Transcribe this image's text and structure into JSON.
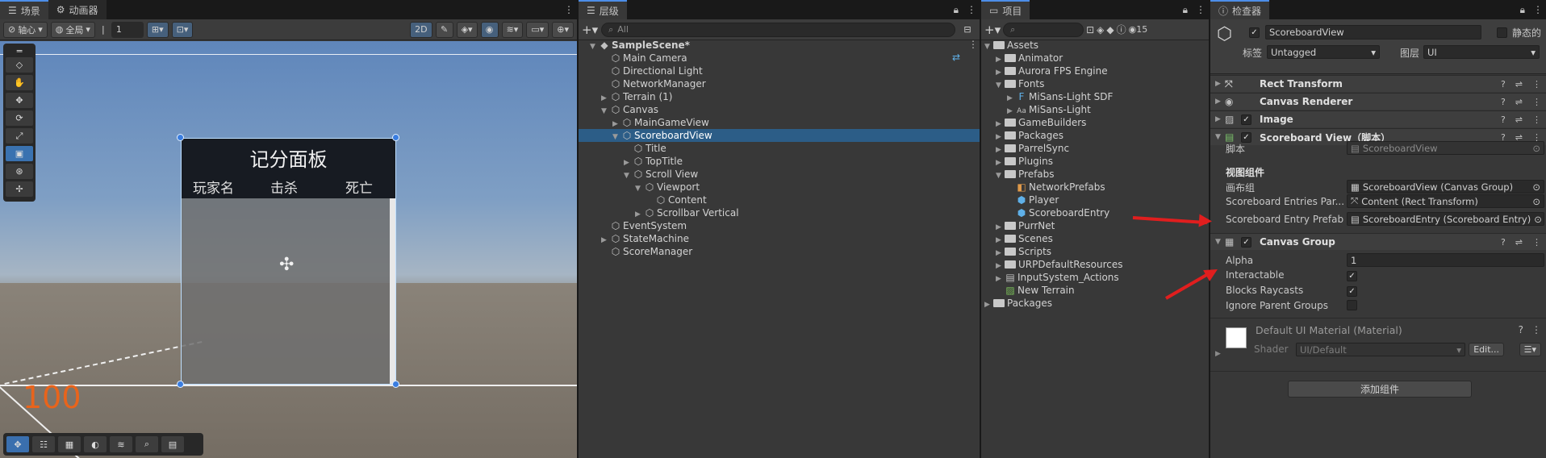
{
  "scene_panel": {
    "tabs": [
      {
        "label": "场景",
        "icon": "menu-icon"
      },
      {
        "label": "动画器",
        "icon": "animator-icon"
      }
    ],
    "toolbar": {
      "pivot": "轴心",
      "global": "全局",
      "grid_value": "1",
      "mode_2d": "2D"
    },
    "canvas_title": "记分面板",
    "columns": [
      "玩家名",
      "击杀",
      "死亡"
    ],
    "overlay_number": "100"
  },
  "hierarchy": {
    "tab": "层级",
    "search_placeholder": "All",
    "items": [
      {
        "label": "SampleScene*",
        "depth": 0,
        "arrow": "▼",
        "icon": "unity-icon",
        "bold": true
      },
      {
        "label": "Main Camera",
        "depth": 1,
        "arrow": "",
        "icon": "cube-icon"
      },
      {
        "label": "Directional Light",
        "depth": 1,
        "arrow": "",
        "icon": "cube-icon"
      },
      {
        "label": "NetworkManager",
        "depth": 1,
        "arrow": "",
        "icon": "cube-icon"
      },
      {
        "label": "Terrain (1)",
        "depth": 1,
        "arrow": "▶",
        "icon": "cube-icon"
      },
      {
        "label": "Canvas",
        "depth": 1,
        "arrow": "▼",
        "icon": "cube-icon"
      },
      {
        "label": "MainGameView",
        "depth": 2,
        "arrow": "▶",
        "icon": "cube-icon"
      },
      {
        "label": "ScoreboardView",
        "depth": 2,
        "arrow": "▼",
        "icon": "cube-icon",
        "selected": true
      },
      {
        "label": "Title",
        "depth": 3,
        "arrow": "",
        "icon": "cube-icon"
      },
      {
        "label": "TopTitle",
        "depth": 3,
        "arrow": "▶",
        "icon": "cube-icon"
      },
      {
        "label": "Scroll View",
        "depth": 3,
        "arrow": "▼",
        "icon": "cube-icon"
      },
      {
        "label": "Viewport",
        "depth": 4,
        "arrow": "▼",
        "icon": "cube-icon"
      },
      {
        "label": "Content",
        "depth": 5,
        "arrow": "",
        "icon": "cube-icon"
      },
      {
        "label": "Scrollbar Vertical",
        "depth": 4,
        "arrow": "▶",
        "icon": "cube-icon"
      },
      {
        "label": "EventSystem",
        "depth": 1,
        "arrow": "",
        "icon": "cube-icon"
      },
      {
        "label": "StateMachine",
        "depth": 1,
        "arrow": "▶",
        "icon": "cube-icon"
      },
      {
        "label": "ScoreManager",
        "depth": 1,
        "arrow": "",
        "icon": "cube-icon"
      }
    ]
  },
  "project": {
    "tab": "项目",
    "badge_count": "15",
    "items": [
      {
        "label": "Assets",
        "depth": 0,
        "arrow": "▼",
        "icon": "folder"
      },
      {
        "label": "Animator",
        "depth": 1,
        "arrow": "▶",
        "icon": "folder"
      },
      {
        "label": "Aurora FPS Engine",
        "depth": 1,
        "arrow": "▶",
        "icon": "folder"
      },
      {
        "label": "Fonts",
        "depth": 1,
        "arrow": "▼",
        "icon": "folder"
      },
      {
        "label": "MiSans-Light SDF",
        "depth": 2,
        "arrow": "▶",
        "icon": "font-asset-icon"
      },
      {
        "label": "MiSans-Light",
        "depth": 2,
        "arrow": "▶",
        "icon": "font-icon"
      },
      {
        "label": "GameBuilders",
        "depth": 1,
        "arrow": "▶",
        "icon": "folder"
      },
      {
        "label": "Packages",
        "depth": 1,
        "arrow": "▶",
        "icon": "folder"
      },
      {
        "label": "ParrelSync",
        "depth": 1,
        "arrow": "▶",
        "icon": "folder"
      },
      {
        "label": "Plugins",
        "depth": 1,
        "arrow": "▶",
        "icon": "folder"
      },
      {
        "label": "Prefabs",
        "depth": 1,
        "arrow": "▼",
        "icon": "folder"
      },
      {
        "label": "NetworkPrefabs",
        "depth": 2,
        "arrow": "",
        "icon": "network-prefab-icon"
      },
      {
        "label": "Player",
        "depth": 2,
        "arrow": "",
        "icon": "prefab-icon"
      },
      {
        "label": "ScoreboardEntry",
        "depth": 2,
        "arrow": "",
        "icon": "prefab-icon"
      },
      {
        "label": "PurrNet",
        "depth": 1,
        "arrow": "▶",
        "icon": "folder"
      },
      {
        "label": "Scenes",
        "depth": 1,
        "arrow": "▶",
        "icon": "folder"
      },
      {
        "label": "Scripts",
        "depth": 1,
        "arrow": "▶",
        "icon": "folder"
      },
      {
        "label": "URPDefaultResources",
        "depth": 1,
        "arrow": "▶",
        "icon": "folder"
      },
      {
        "label": "InputSystem_Actions",
        "depth": 1,
        "arrow": "▶",
        "icon": "input-actions-icon"
      },
      {
        "label": "New Terrain",
        "depth": 1,
        "arrow": "",
        "icon": "terrain-icon"
      },
      {
        "label": "Packages",
        "depth": 0,
        "arrow": "▶",
        "icon": "folder"
      }
    ]
  },
  "inspector": {
    "tab": "检查器",
    "object_name": "ScoreboardView",
    "static_label": "静态的",
    "tag_label": "标签",
    "tag_value": "Untagged",
    "layer_label": "图层",
    "layer_value": "UI",
    "components": [
      {
        "label": "Rect Transform",
        "icon": "rect-transform-icon",
        "checkbox": false
      },
      {
        "label": "Canvas Renderer",
        "icon": "eye-icon",
        "checkbox": false
      },
      {
        "label": "Image",
        "icon": "image-icon",
        "checkbox": true
      },
      {
        "label": "Scoreboard View（脚本）",
        "icon": "script-icon",
        "checkbox": true
      }
    ],
    "script": {
      "label": "脚本",
      "value": "ScoreboardView"
    },
    "section_title": "视图组件",
    "fields": [
      {
        "label": "画布组",
        "value": "ScoreboardView (Canvas Group)"
      },
      {
        "label": "Scoreboard Entries Par...",
        "value": "Content (Rect Transform)"
      },
      {
        "label": "Scoreboard Entry Prefab",
        "value": "ScoreboardEntry (Scoreboard Entry)"
      }
    ],
    "canvas_group": {
      "label": "Canvas Group",
      "alpha_label": "Alpha",
      "alpha_value": "1",
      "interactable_label": "Interactable",
      "interactable": true,
      "blocks_label": "Blocks Raycasts",
      "blocks": true,
      "ignore_label": "Ignore Parent Groups",
      "ignore": false
    },
    "material": {
      "name": "Default UI Material (Material)",
      "shader_label": "Shader",
      "shader_value": "UI/Default",
      "edit_label": "Edit..."
    },
    "add_component": "添加组件"
  },
  "colors": {
    "accent": "#4d8ee8",
    "selection": "#2c5d87",
    "arrow_red": "#e01e1e",
    "number_orange": "#e8641c"
  }
}
